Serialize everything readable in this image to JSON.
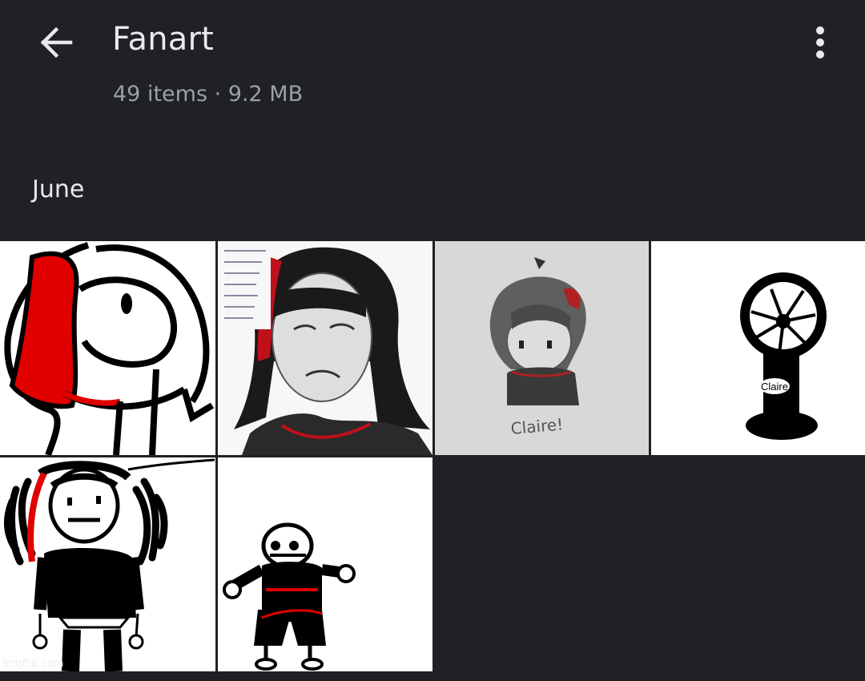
{
  "header": {
    "title": "Fanart",
    "subtitle": "49 items · 9.2 MB",
    "back_icon": "arrow-back-icon",
    "menu_icon": "more-vert-icon"
  },
  "sections": [
    {
      "label": "June",
      "items": [
        {
          "name": "fanart-thumbnail-1"
        },
        {
          "name": "fanart-thumbnail-2"
        },
        {
          "name": "fanart-thumbnail-3",
          "caption": "Claire!"
        },
        {
          "name": "fanart-thumbnail-4",
          "caption": "Claire"
        },
        {
          "name": "fanart-thumbnail-5"
        },
        {
          "name": "fanart-thumbnail-6"
        }
      ]
    }
  ],
  "watermark": "imgflip.com",
  "colors": {
    "background": "#202124",
    "title": "#e8eaed",
    "subtitle": "#9aa0a6",
    "accent_red": "#e00000"
  }
}
